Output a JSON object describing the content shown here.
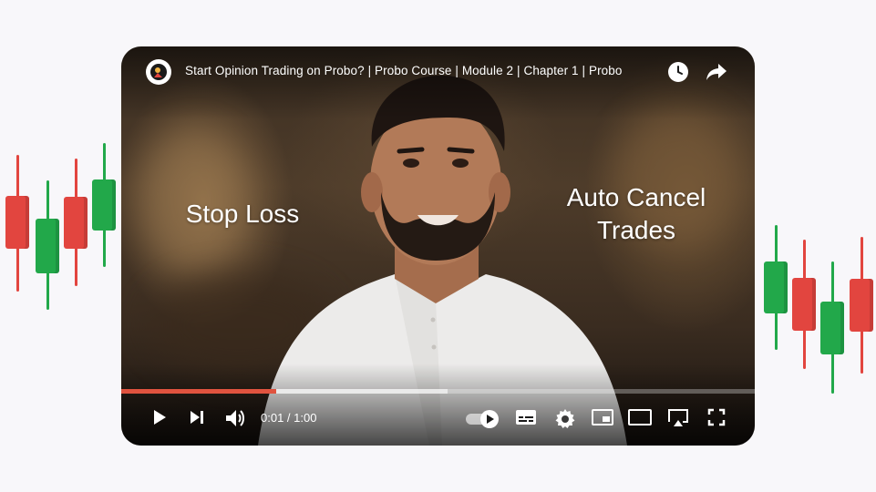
{
  "player": {
    "title": "Start Opinion Trading on Probo? | Probo Course | Module 2 | Chapter 1 | Probo",
    "overlay_left": "Stop Loss",
    "overlay_right": "Auto Cancel Trades",
    "time_display": "0:01 / 1:00",
    "progress": {
      "played_fraction": 0.245,
      "buffered_fraction": 0.515
    },
    "top_icons": [
      "clock-icon",
      "share-icon"
    ],
    "control_icons": [
      "play-icon",
      "next-icon",
      "volume-icon",
      "autoplay-toggle",
      "subtitles-icon",
      "settings-icon",
      "miniplayer-icon",
      "theater-icon",
      "cast-icon",
      "fullscreen-icon"
    ],
    "colors": {
      "progress_played": "#e0533f",
      "candle_red": "#e2453f",
      "candle_green": "#22a84a"
    }
  }
}
